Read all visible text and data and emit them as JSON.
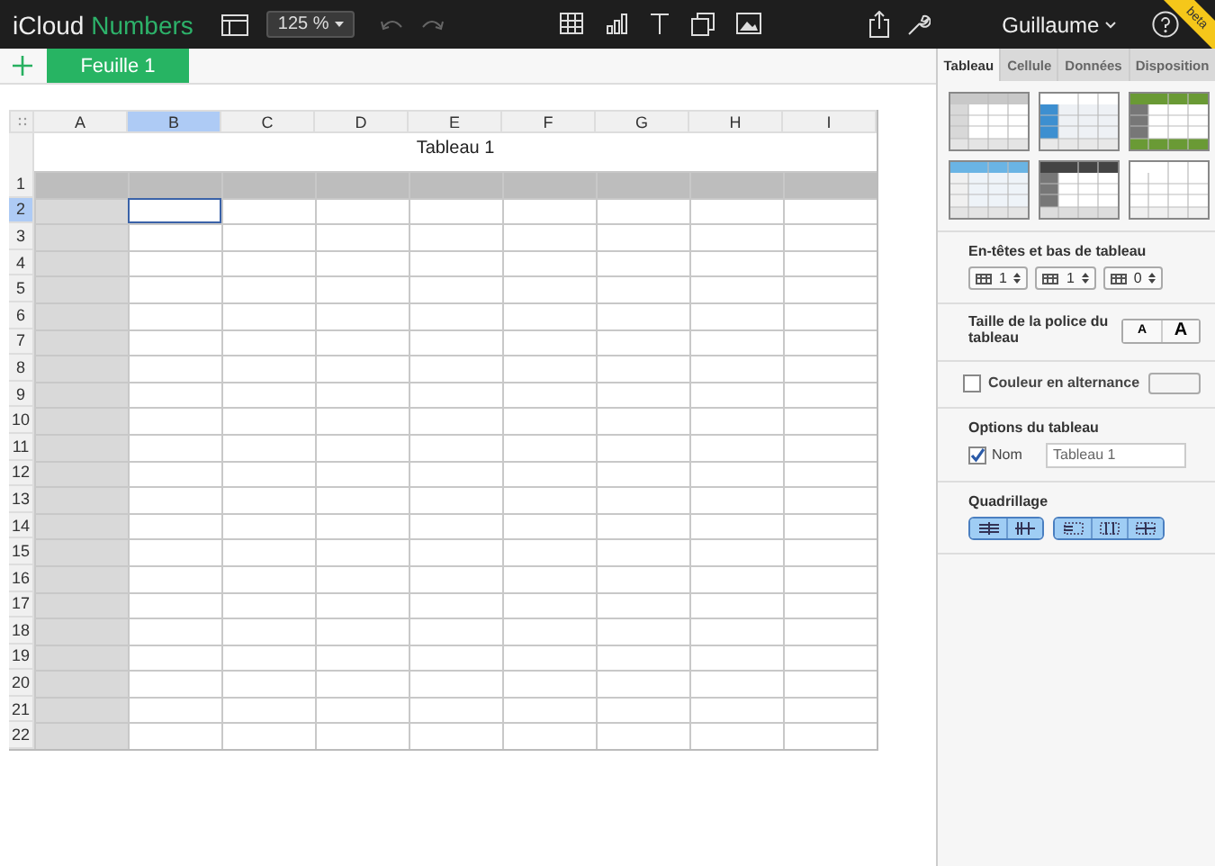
{
  "app": {
    "brand": "iCloud",
    "product": "Numbers"
  },
  "toolbar": {
    "zoom": "125 %",
    "user": "Guillaume",
    "badge": "beta"
  },
  "sheets": [
    {
      "label": "Feuille 1",
      "selected": true
    }
  ],
  "table": {
    "title": "Tableau 1",
    "columns": [
      {
        "label": "A",
        "selected": false
      },
      {
        "label": "B",
        "selected": true
      },
      {
        "label": "C",
        "selected": false
      },
      {
        "label": "D",
        "selected": false
      },
      {
        "label": "E",
        "selected": false
      },
      {
        "label": "F",
        "selected": false
      },
      {
        "label": "G",
        "selected": false
      },
      {
        "label": "H",
        "selected": false
      },
      {
        "label": "I",
        "selected": false
      }
    ],
    "rows": [
      {
        "label": "1",
        "selected": false
      },
      {
        "label": "2",
        "selected": true
      },
      {
        "label": "3",
        "selected": false
      },
      {
        "label": "4",
        "selected": false
      },
      {
        "label": "5",
        "selected": false
      },
      {
        "label": "6",
        "selected": false
      },
      {
        "label": "7",
        "selected": false
      },
      {
        "label": "8",
        "selected": false
      },
      {
        "label": "9",
        "selected": false
      },
      {
        "label": "10",
        "selected": false
      },
      {
        "label": "11",
        "selected": false
      },
      {
        "label": "12",
        "selected": false
      },
      {
        "label": "13",
        "selected": false
      },
      {
        "label": "14",
        "selected": false
      },
      {
        "label": "15",
        "selected": false
      },
      {
        "label": "16",
        "selected": false
      },
      {
        "label": "17",
        "selected": false
      },
      {
        "label": "18",
        "selected": false
      },
      {
        "label": "19",
        "selected": false
      },
      {
        "label": "20",
        "selected": false
      },
      {
        "label": "21",
        "selected": false
      },
      {
        "label": "22",
        "selected": false
      }
    ]
  },
  "inspector": {
    "tabs": [
      {
        "label": "Tableau",
        "selected": true
      },
      {
        "label": "Cellule",
        "selected": false
      },
      {
        "label": "Données",
        "selected": false
      },
      {
        "label": "Disposition",
        "selected": false
      }
    ],
    "styles": [
      {
        "kind": "grey"
      },
      {
        "kind": "blue"
      },
      {
        "kind": "green"
      },
      {
        "kind": "lightblue"
      },
      {
        "kind": "dark"
      },
      {
        "kind": "plain"
      }
    ],
    "headers": {
      "title": "En-têtes et bas de tableau",
      "steppers": [
        "1",
        "1",
        "0"
      ]
    },
    "font_size": {
      "title": "Taille de la police du tableau",
      "buttons": [
        "A",
        "A"
      ]
    },
    "alternating": {
      "label": "Couleur en alternance",
      "checked": false
    },
    "options": {
      "title": "Options du tableau",
      "name_label": "Nom",
      "name_checked": true,
      "name_value": "Tableau 1"
    },
    "grid": {
      "title": "Quadrillage",
      "buttons": [
        {
          "selected": true
        },
        {
          "selected": true
        },
        {
          "selected": true
        },
        {
          "selected": true
        },
        {
          "selected": true
        }
      ]
    }
  }
}
